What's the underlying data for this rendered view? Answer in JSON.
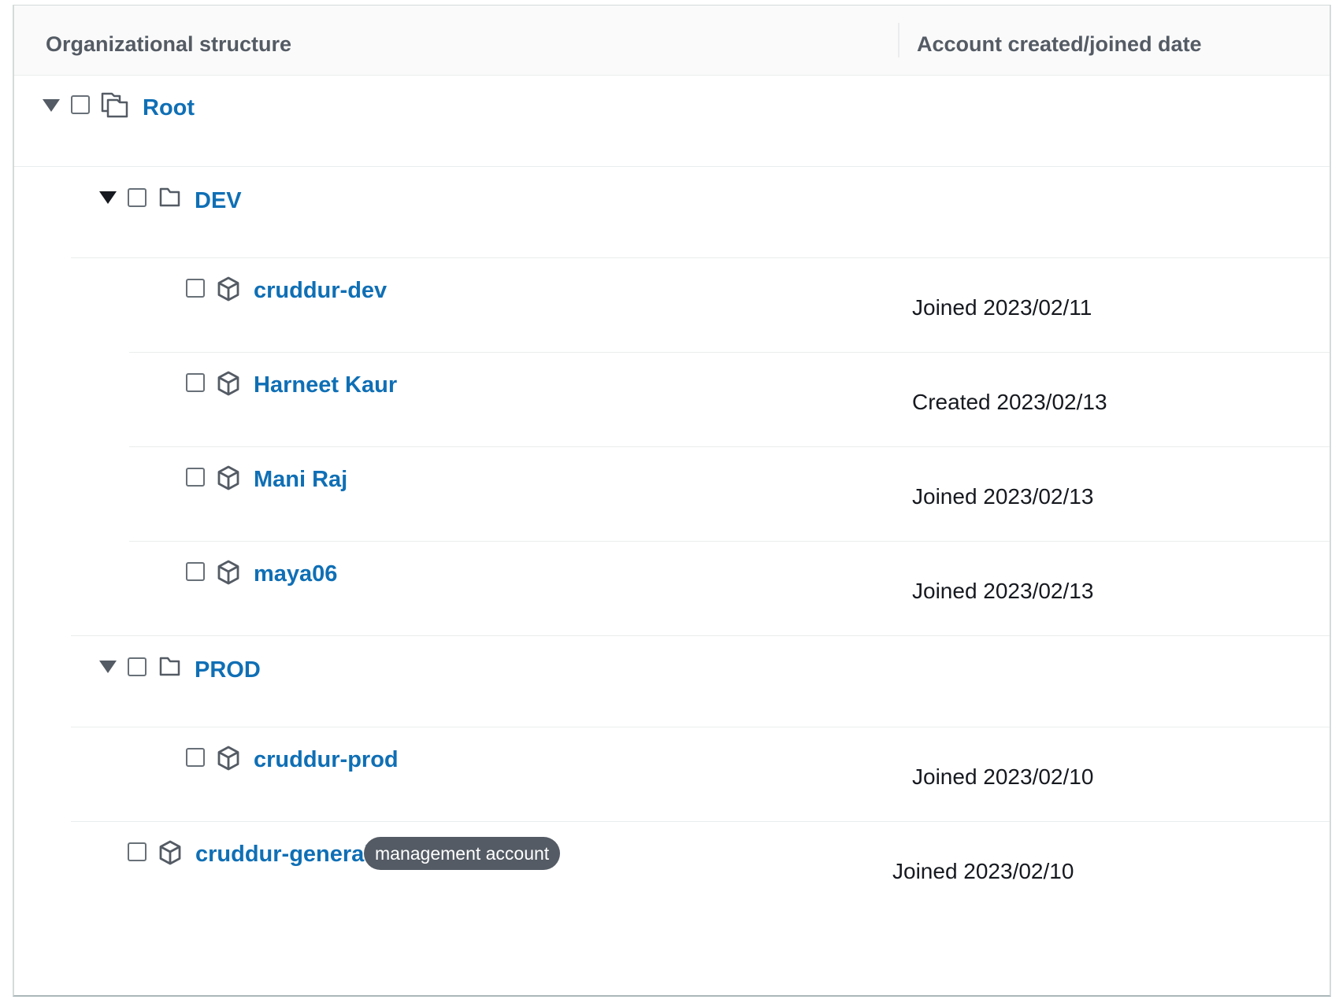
{
  "table": {
    "headers": {
      "org_structure": "Organizational structure",
      "date": "Account created/joined date"
    }
  },
  "tree": {
    "root": {
      "label": "Root"
    },
    "ous": [
      {
        "label": "DEV",
        "accounts": [
          {
            "name": "cruddur-dev",
            "date": "Joined 2023/02/11"
          },
          {
            "name": "Harneet Kaur",
            "date": "Created 2023/02/13"
          },
          {
            "name": "Mani Raj",
            "date": "Joined 2023/02/13"
          },
          {
            "name": "maya06",
            "date": "Joined 2023/02/13"
          }
        ]
      },
      {
        "label": "PROD",
        "accounts": [
          {
            "name": "cruddur-prod",
            "date": "Joined 2023/02/10"
          }
        ]
      }
    ],
    "management": {
      "name": "cruddur-general",
      "badge": "management account",
      "date": "Joined 2023/02/10"
    }
  },
  "colors": {
    "link": "#0f6fb5",
    "badge_bg": "#545b64",
    "header_bg": "#fafafa"
  },
  "icons": {
    "expand": "caret-down-icon",
    "root": "root-icon",
    "ou": "folder-icon",
    "account": "cube-icon"
  }
}
